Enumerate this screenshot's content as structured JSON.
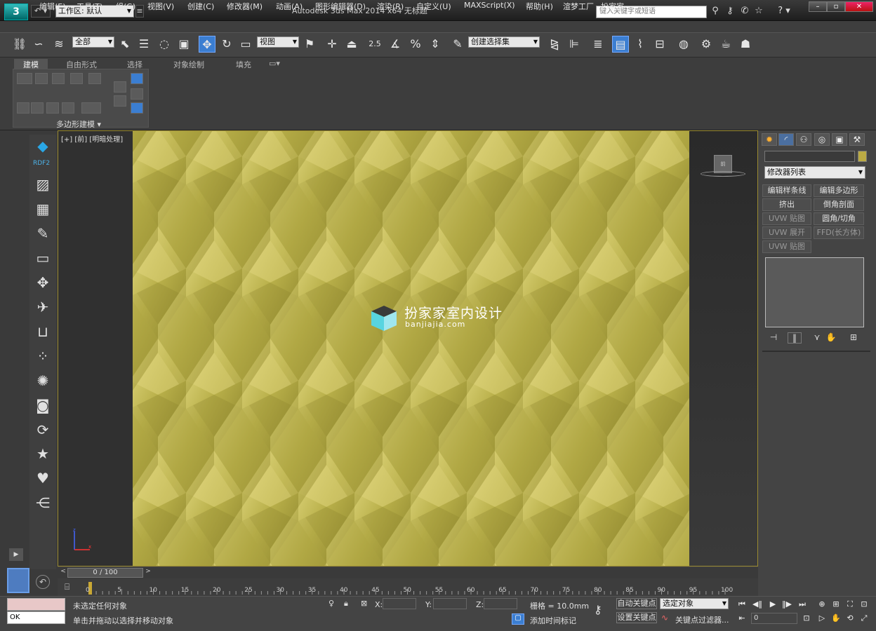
{
  "titlebar": {
    "workspace_label": "工作区: 默认",
    "title": "Autodesk 3ds Max  2014 x64     无标题",
    "search_placeholder": "键入关键字或短语",
    "logo_glyph": "3"
  },
  "menu": [
    "编辑(E)",
    "工具(T)",
    "组(G)",
    "视图(V)",
    "创建(C)",
    "修改器(M)",
    "动画(A)",
    "图形编辑器(D)",
    "渲染(R)",
    "自定义(U)",
    "MAXScript(X)",
    "帮助(H)",
    "渲梦工厂",
    "扮家家"
  ],
  "toolbar": {
    "selection_filter": "全部",
    "ref_coord": "视图",
    "named_selection": "创建选择集",
    "snap_label": "2.5"
  },
  "ribbon": {
    "tabs": [
      "建模",
      "自由形式",
      "选择",
      "对象绘制",
      "填充"
    ],
    "panel_label": "多边形建模 ▾"
  },
  "sidebar": {
    "rdf_label": "RDF2",
    "icons": [
      "image-icon",
      "grid-icon",
      "edit-icon",
      "monitor-icon",
      "move-icon",
      "plane-icon",
      "inbox-icon",
      "dots-icon",
      "sun-icon",
      "camera-icon",
      "refresh-icon",
      "star-icon",
      "heart-icon",
      "share-icon"
    ]
  },
  "viewport": {
    "label": "[+] [前] [明暗处理]",
    "viewcube_label": "前",
    "watermark_title": "扮家家室内设计",
    "watermark_sub": "banjiajia.com"
  },
  "command_panel": {
    "modifier_list": "修改器列表",
    "buttons": [
      [
        "编辑样条线",
        "编辑多边形"
      ],
      [
        "挤出",
        "倒角剖面"
      ],
      [
        "UVW 贴图",
        "圆角/切角"
      ],
      [
        "UVW 展开",
        "FFD(长方体)"
      ],
      [
        "UVW 贴图",
        ""
      ]
    ]
  },
  "timeline": {
    "slider": "0 / 100",
    "ticks": [
      "0",
      "5",
      "10",
      "15",
      "20",
      "25",
      "30",
      "35",
      "40",
      "45",
      "50",
      "55",
      "60",
      "65",
      "70",
      "75",
      "80",
      "85",
      "90",
      "95",
      "100"
    ]
  },
  "status": {
    "maxscript_value": "OK",
    "line1": "未选定任何对象",
    "line2": "单击并拖动以选择并移动对象",
    "x_label": "X:",
    "y_label": "Y:",
    "z_label": "Z:",
    "grid": "栅格 = 10.0mm",
    "add_time_tag": "添加时间标记",
    "auto_key": "自动关键点",
    "set_key": "设置关键点",
    "key_mode": "选定对象",
    "key_filters": "关键点过滤器...",
    "frame": "0"
  },
  "colors": {
    "accent": "#3b7ed1",
    "pattern_base": "#b5ae45",
    "viewport_border": "#9a8a30"
  }
}
